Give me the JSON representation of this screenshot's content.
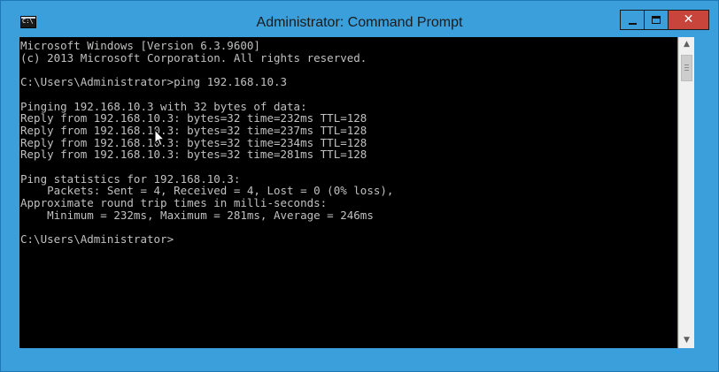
{
  "window": {
    "title": "Administrator: Command Prompt",
    "icon": "cmd-icon",
    "title_color": "#3a9fda",
    "close_color": "#c7453b"
  },
  "console": {
    "background": "#000000",
    "foreground": "#c0c0c0",
    "lines": [
      "Microsoft Windows [Version 6.3.9600]",
      "(c) 2013 Microsoft Corporation. All rights reserved.",
      "",
      "C:\\Users\\Administrator>ping 192.168.10.3",
      "",
      "Pinging 192.168.10.3 with 32 bytes of data:",
      "Reply from 192.168.10.3: bytes=32 time=232ms TTL=128",
      "Reply from 192.168.10.3: bytes=32 time=237ms TTL=128",
      "Reply from 192.168.10.3: bytes=32 time=234ms TTL=128",
      "Reply from 192.168.10.3: bytes=32 time=281ms TTL=128",
      "",
      "Ping statistics for 192.168.10.3:",
      "    Packets: Sent = 4, Received = 4, Lost = 0 (0% loss),",
      "Approximate round trip times in milli-seconds:",
      "    Minimum = 232ms, Maximum = 281ms, Average = 246ms",
      "",
      "C:\\Users\\Administrator>"
    ]
  },
  "icons": {
    "minimize": "minimize-icon",
    "maximize": "maximize-icon",
    "close": "close-icon",
    "scroll_up": "scroll-up-arrow-icon",
    "scroll_down": "scroll-down-arrow-icon",
    "cursor": "mouse-pointer-icon"
  }
}
